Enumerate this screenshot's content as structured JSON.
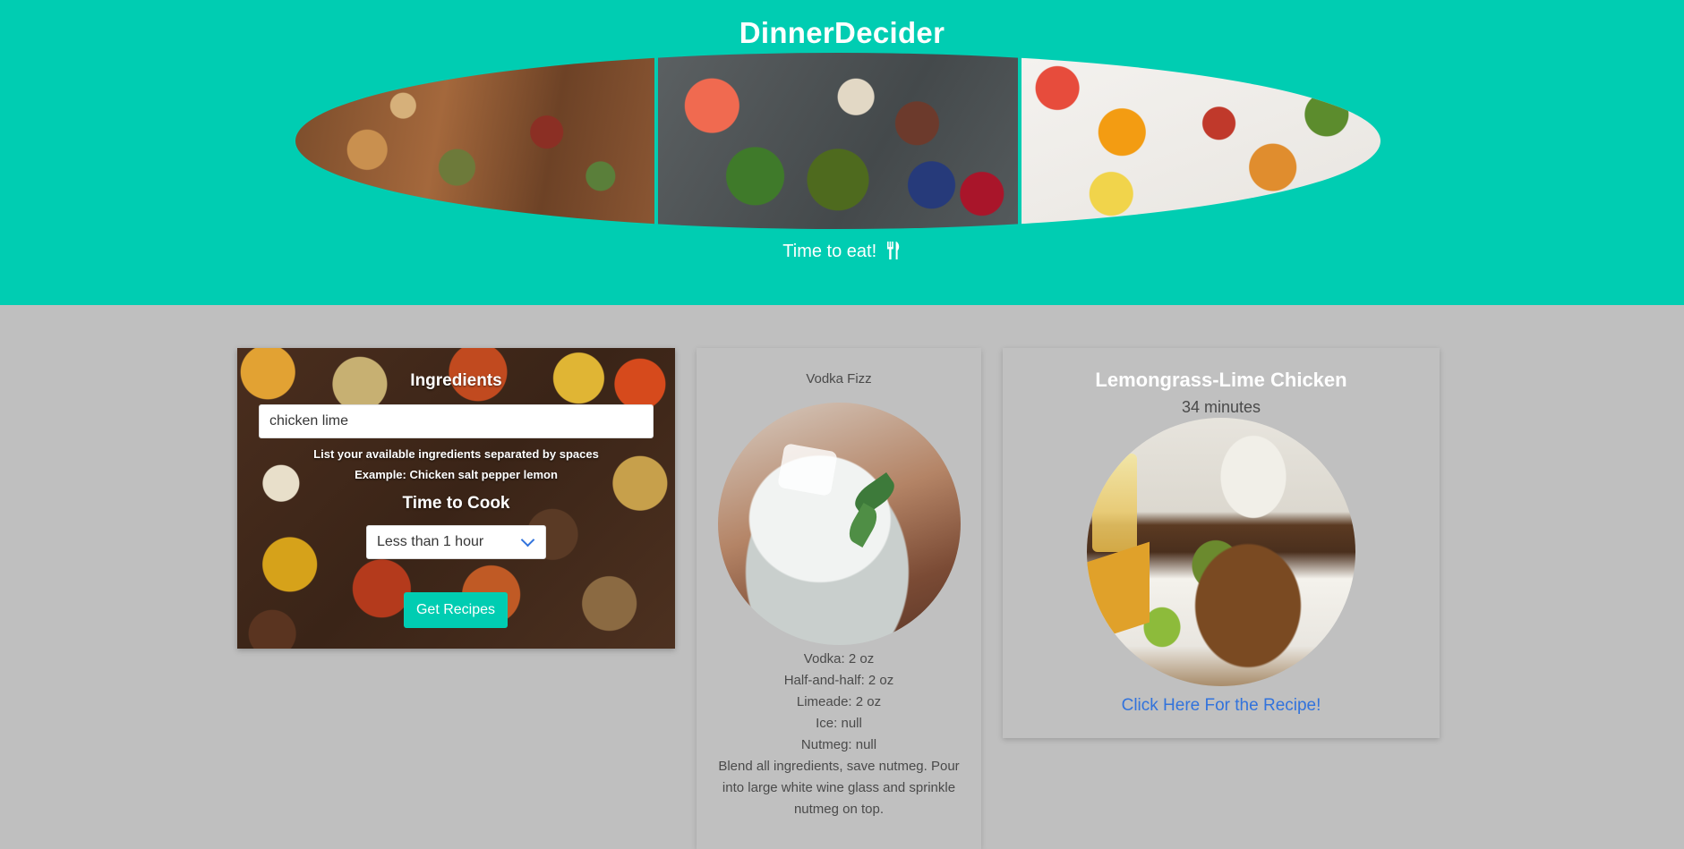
{
  "header": {
    "brand": "DinnerDecider",
    "tagline": "Time to eat!"
  },
  "search": {
    "title": "Ingredients",
    "ingredients_value": "chicken lime",
    "help_line_1": "List your available ingredients separated by spaces",
    "help_line_2": "Example: Chicken salt pepper lemon",
    "time_title": "Time to Cook",
    "time_selected": "Less than 1 hour",
    "button_label": "Get Recipes"
  },
  "drink": {
    "name": "Vodka Fizz",
    "ingredients": [
      "Vodka: 2 oz",
      "Half-and-half: 2 oz",
      "Limeade: 2 oz",
      "Ice: null",
      "Nutmeg: null"
    ],
    "instructions": "Blend all ingredients, save nutmeg. Pour into large white wine glass and sprinkle nutmeg on top."
  },
  "recipe": {
    "title": "Lemongrass-Lime Chicken",
    "time": "34 minutes",
    "link_text": "Click Here For the Recipe!"
  },
  "colors": {
    "accent": "#00cdb2",
    "page_bg": "#bfbfbf",
    "link": "#3273dc"
  }
}
